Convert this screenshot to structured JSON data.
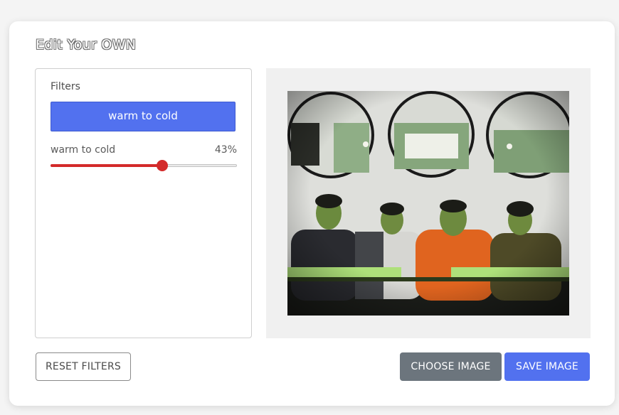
{
  "page": {
    "title": "Edit Your OWN"
  },
  "filters_panel": {
    "heading": "Filters",
    "active_filter_button": "warm to cold",
    "slider": {
      "label": "warm to cold",
      "value_text": "43%",
      "value": 0.6
    }
  },
  "preview": {
    "image_description_icon": "photo-of-four-people"
  },
  "actions": {
    "reset_label": "RESET FILTERS",
    "choose_label": "CHOOSE IMAGE",
    "save_label": "SAVE IMAGE"
  },
  "colors": {
    "primary": "#5271ef",
    "slider_fill": "#d32a2a",
    "secondary": "#6c757d"
  }
}
